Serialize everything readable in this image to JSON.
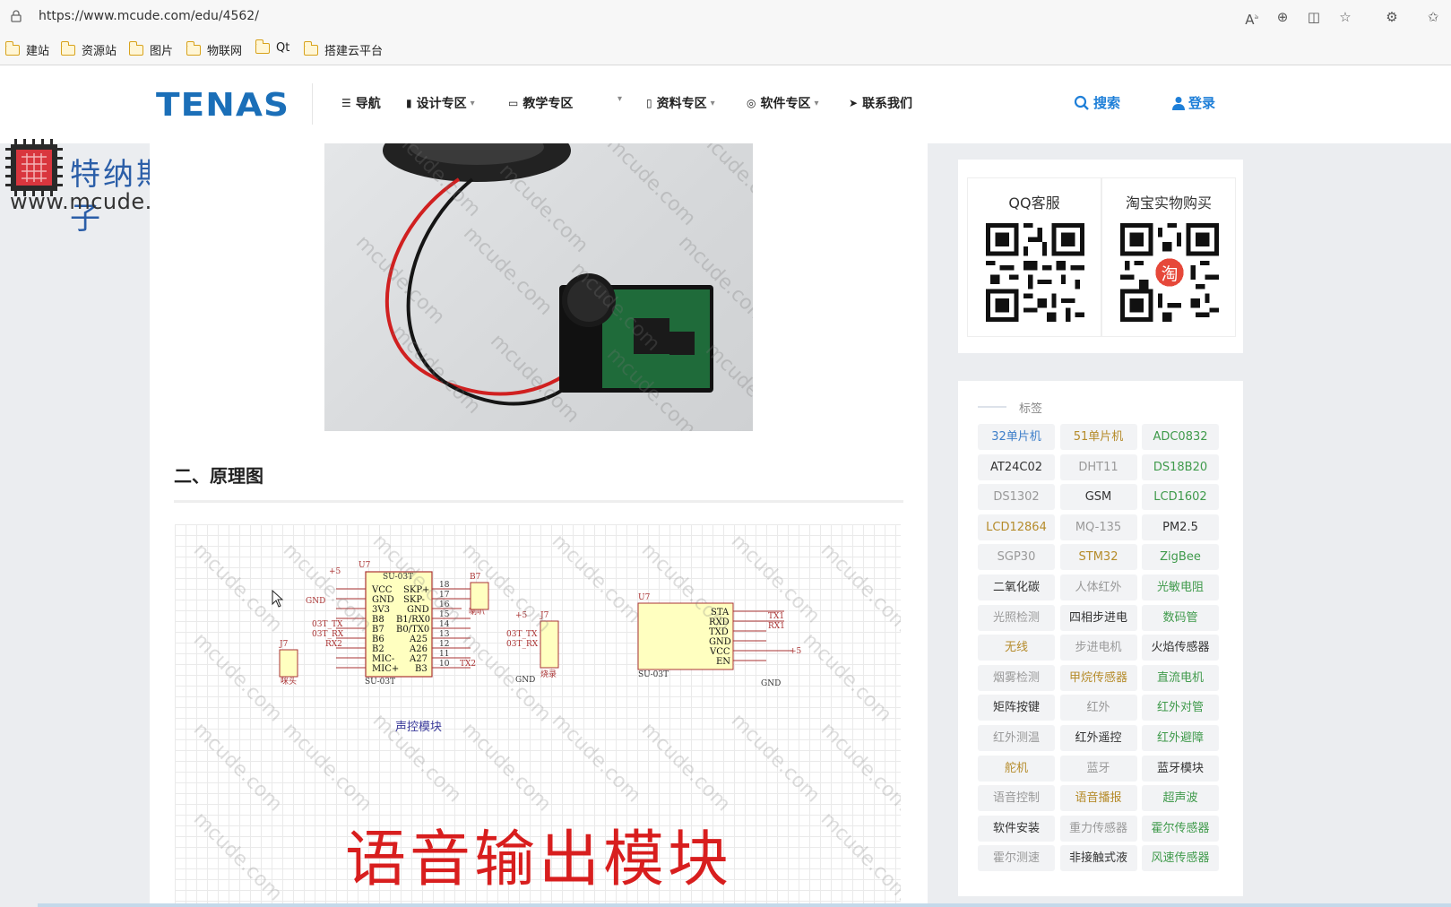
{
  "browser": {
    "url": "https://www.mcude.com/edu/4562/",
    "bookmarks": [
      "建站",
      "资源站",
      "图片",
      "物联网",
      "Qt",
      "搭建云平台"
    ]
  },
  "site": {
    "logo": "TENAS",
    "brand_cn": "特纳斯电子",
    "brand_url": "www.mcude.com",
    "menu": [
      {
        "label": "导航",
        "icon": "list-icon",
        "caret": false
      },
      {
        "label": "设计专区",
        "icon": "chip-icon",
        "caret": true
      },
      {
        "label": "教学专区",
        "icon": "book-icon",
        "caret": true
      },
      {
        "label": "资料专区",
        "icon": "file-icon",
        "caret": true
      },
      {
        "label": "软件专区",
        "icon": "app-icon",
        "caret": true
      },
      {
        "label": "联系我们",
        "icon": "send-icon",
        "caret": false
      }
    ],
    "search_label": "搜索",
    "login_label": "登录"
  },
  "article": {
    "section_title": "二、原理图",
    "watermark": "mcude.com",
    "schematic_label": "声控模块",
    "schematic_big_title": "语音输出模块",
    "schematic_parts": {
      "u7": "U7",
      "chip": "SU-03T",
      "j7": "J7",
      "b7": "B7",
      "left_pins": [
        "VCC",
        "GND",
        "3V3",
        "B8",
        "B7",
        "B6",
        "B2",
        "MIC-",
        "MIC+"
      ],
      "right_pins": [
        "SKP+",
        "SKP-",
        "GND",
        "B1/RX0",
        "B0/TX0",
        "A25",
        "A26",
        "A27",
        "B3"
      ],
      "right_nums": [
        "18",
        "17",
        "16",
        "15",
        "14",
        "13",
        "12",
        "11",
        "10"
      ],
      "nets": [
        "+5",
        "GND",
        "03T_TX",
        "03T_RX",
        "RX2",
        "TX2",
        "喇叭",
        "咪头",
        "烧录"
      ],
      "u7b_pins": [
        "STA",
        "RXD",
        "TXD",
        "GND",
        "VCC",
        "EN"
      ],
      "u7b_nets": [
        "TX1",
        "RX1",
        "+5",
        "GND"
      ]
    }
  },
  "sidebar": {
    "qq_title": "QQ客服",
    "taobao_title": "淘宝实物购买",
    "taobao_badge": "淘",
    "tags_title": "标签",
    "tags": [
      {
        "label": "32单片机",
        "color": "#3d7ec9"
      },
      {
        "label": "51单片机",
        "color": "#b58b2a"
      },
      {
        "label": "ADC0832",
        "color": "#3f9a4b"
      },
      {
        "label": "AT24C02",
        "color": "#333333"
      },
      {
        "label": "DHT11",
        "color": "#999999"
      },
      {
        "label": "DS18B20",
        "color": "#3f9a4b"
      },
      {
        "label": "DS1302",
        "color": "#999999"
      },
      {
        "label": "GSM",
        "color": "#333333"
      },
      {
        "label": "LCD1602",
        "color": "#3f9a4b"
      },
      {
        "label": "LCD12864",
        "color": "#b58b2a"
      },
      {
        "label": "MQ-135",
        "color": "#999999"
      },
      {
        "label": "PM2.5",
        "color": "#333333"
      },
      {
        "label": "SGP30",
        "color": "#999999"
      },
      {
        "label": "STM32",
        "color": "#b58b2a"
      },
      {
        "label": "ZigBee",
        "color": "#3f9a4b"
      },
      {
        "label": "二氧化碳",
        "color": "#333333"
      },
      {
        "label": "人体红外",
        "color": "#999999"
      },
      {
        "label": "光敏电阻",
        "color": "#3f9a4b"
      },
      {
        "label": "光照检测",
        "color": "#999999"
      },
      {
        "label": "四相步进电",
        "color": "#333333"
      },
      {
        "label": "数码管",
        "color": "#3f9a4b"
      },
      {
        "label": "无线",
        "color": "#b58b2a"
      },
      {
        "label": "步进电机",
        "color": "#999999"
      },
      {
        "label": "火焰传感器",
        "color": "#333333"
      },
      {
        "label": "烟雾检测",
        "color": "#999999"
      },
      {
        "label": "甲烷传感器",
        "color": "#b58b2a"
      },
      {
        "label": "直流电机",
        "color": "#3f9a4b"
      },
      {
        "label": "矩阵按键",
        "color": "#333333"
      },
      {
        "label": "红外",
        "color": "#999999"
      },
      {
        "label": "红外对管",
        "color": "#3f9a4b"
      },
      {
        "label": "红外测温",
        "color": "#999999"
      },
      {
        "label": "红外遥控",
        "color": "#333333"
      },
      {
        "label": "红外避障",
        "color": "#3f9a4b"
      },
      {
        "label": "舵机",
        "color": "#b58b2a"
      },
      {
        "label": "蓝牙",
        "color": "#999999"
      },
      {
        "label": "蓝牙模块",
        "color": "#333333"
      },
      {
        "label": "语音控制",
        "color": "#999999"
      },
      {
        "label": "语音播报",
        "color": "#b58b2a"
      },
      {
        "label": "超声波",
        "color": "#3f9a4b"
      },
      {
        "label": "软件安装",
        "color": "#333333"
      },
      {
        "label": "重力传感器",
        "color": "#999999"
      },
      {
        "label": "霍尔传感器",
        "color": "#3f9a4b"
      },
      {
        "label": "霍尔测速",
        "color": "#999999"
      },
      {
        "label": "非接触式液",
        "color": "#333333"
      },
      {
        "label": "风速传感器",
        "color": "#3f9a4b"
      }
    ]
  }
}
